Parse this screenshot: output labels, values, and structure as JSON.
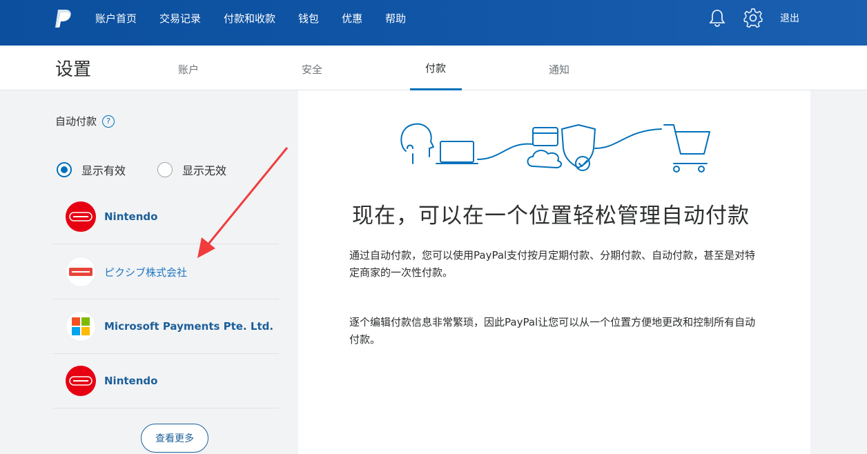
{
  "nav": {
    "items": [
      "账户首页",
      "交易记录",
      "付款和收款",
      "钱包",
      "优惠",
      "帮助"
    ],
    "logout": "退出",
    "icons": [
      "bell-icon",
      "gear-icon"
    ],
    "brand_color": "#0b4f9e"
  },
  "subheader": {
    "title": "设置",
    "tabs": [
      {
        "label": "账户",
        "active": false
      },
      {
        "label": "安全",
        "active": false
      },
      {
        "label": "付款",
        "active": true
      },
      {
        "label": "通知",
        "active": false
      }
    ]
  },
  "sidebar": {
    "title": "自动付款",
    "help_icon": "?",
    "filters": [
      {
        "label": "显示有效",
        "selected": true
      },
      {
        "label": "显示无效",
        "selected": false
      }
    ],
    "merchants": [
      {
        "name": "Nintendo",
        "logo": "nintendo-logo"
      },
      {
        "name": "ピクシブ株式会社",
        "logo": "booth-logo"
      },
      {
        "name": "Microsoft Payments Pte. Ltd.",
        "logo": "microsoft-logo"
      },
      {
        "name": "Nintendo",
        "logo": "nintendo-logo"
      }
    ],
    "see_more": "查看更多"
  },
  "main": {
    "headline": "现在，可以在一个位置轻松管理自动付款",
    "para1": "通过自动付款，您可以使用PayPal支付按月定期付款、分期付款、自动付款，甚至是对特定商家的一次性付款。",
    "para2": "逐个编辑付款信息非常繁琐，因此PayPal让您可以从一个位置方便地更改和控制所有自动付款。"
  },
  "annotation": {
    "color": "#f03c3c"
  }
}
